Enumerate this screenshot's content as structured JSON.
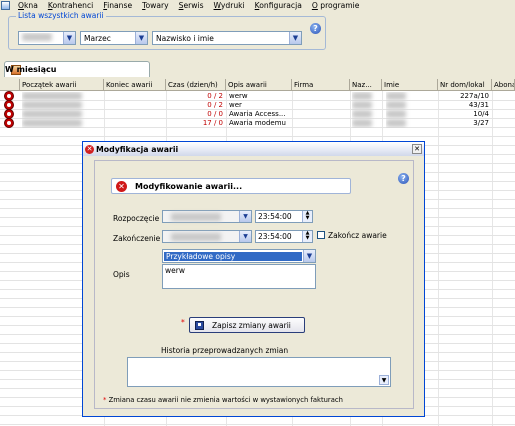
{
  "menu": {
    "items": [
      "Okna",
      "Kontrahenci",
      "Finanse",
      "Towary",
      "Serwis",
      "Wydruki",
      "Konfiguracja",
      "O programie"
    ]
  },
  "filter": {
    "legend": "Lista wszystkich awarii",
    "year_value": "",
    "month_value": "Marzec",
    "sort_value": "Nazwisko i imie"
  },
  "tab": {
    "label": "W miesiącu"
  },
  "grid": {
    "headers": [
      "Początek awarii",
      "Koniec awarii",
      "Czas (dzien/h)",
      "Opis awarii",
      "Firma",
      "Naz...",
      "Imie",
      "Nr dom/lokal",
      "Abona"
    ],
    "rows": [
      {
        "czas": "0 / 2",
        "opis": "werw",
        "nr": "227a/10"
      },
      {
        "czas": "0 / 2",
        "opis": "wer",
        "nr": "43/31"
      },
      {
        "czas": "0 / 0",
        "opis": "Awaria Access...",
        "nr": "10/4"
      },
      {
        "czas": "17 / 0",
        "opis": "Awaria modemu",
        "nr": "3/27"
      }
    ]
  },
  "dialog": {
    "title": "Modyfikacja awarii",
    "header": "Modyfikowanie awarii...",
    "start_label": "Rozpoczęcie",
    "start_time": "23:54:00",
    "end_label": "Zakończenie",
    "end_time": "23:54:00",
    "finish_label": "Zakończ awarie",
    "sample_descriptions": "Przykładowe opisy",
    "desc_label": "Opis",
    "desc_value": "werw",
    "save_label": "Zapisz zmiany awarii",
    "history_label": "Historia przeprowadzanych zmian",
    "note": "Zmiana czasu awarii nie zmienia wartości w wystawionych fakturach"
  }
}
